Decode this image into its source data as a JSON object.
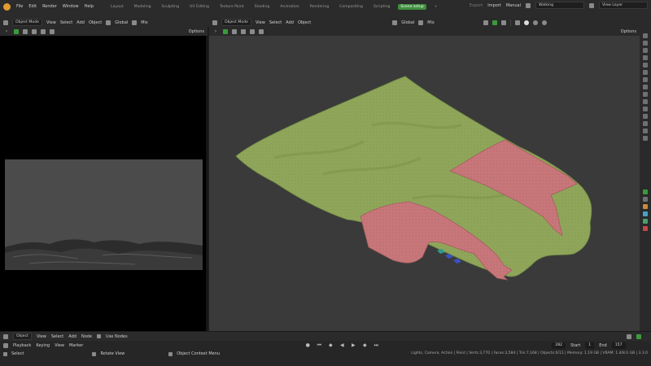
{
  "menubar": {
    "items": [
      "File",
      "Edit",
      "Render",
      "Window",
      "Help"
    ]
  },
  "workspaces": [
    {
      "label": "Layout",
      "active": false
    },
    {
      "label": "Modeling",
      "active": false
    },
    {
      "label": "Sculpting",
      "active": false
    },
    {
      "label": "UV Editing",
      "active": false
    },
    {
      "label": "Texture Paint",
      "active": false
    },
    {
      "label": "Shading",
      "active": false
    },
    {
      "label": "Animation",
      "active": false
    },
    {
      "label": "Rendering",
      "active": false
    },
    {
      "label": "Compositing",
      "active": false
    },
    {
      "label": "Scripting",
      "active": false
    },
    {
      "label": "Scene setup",
      "active": true
    }
  ],
  "top_right": {
    "export": "Export",
    "import": "Import",
    "manual": "Manual",
    "scene": "Walking",
    "view_layer": "View Layer"
  },
  "left_header": {
    "mode": "Object Mode",
    "view": "View",
    "select": "Select",
    "add": "Add",
    "object": "Object",
    "orientation": "Global",
    "snap": "Mix",
    "options": "Options"
  },
  "right_header": {
    "mode": "Object Mode",
    "view": "View",
    "select": "Select",
    "add": "Add",
    "object": "Object",
    "orientation": "Global",
    "snap": "Mix",
    "options": "Options"
  },
  "timeline_header": {
    "editor": "Object",
    "view": "View",
    "select": "Select",
    "add": "Add",
    "node": "Node",
    "use_nodes": "Use Nodes"
  },
  "playback": {
    "playback": "Playback",
    "keying": "Keying",
    "view": "View",
    "marker": "Marker",
    "current_frame": "282",
    "start_label": "Start",
    "start": "1",
    "end_label": "End",
    "end": "157"
  },
  "status": {
    "select": "Select",
    "rotate": "Rotate View",
    "context": "Object Context Menu",
    "info": "Lights, Camera, Action | Point | Verts:3,770 | Faces:3,584 | Tris:7,168 | Objects:0/11 | Memory: 1.19 GB | VRAM: 1.4/8.0 GB | 3.3.0"
  },
  "colors": {
    "accent": "#3f8f3f",
    "terrain": "#8fa65a",
    "terrain_dark": "#6f8a42",
    "plot": "#c7777a",
    "plot_dark": "#a75c60",
    "water": "#2d9a8e",
    "blue": "#3a52c4"
  }
}
